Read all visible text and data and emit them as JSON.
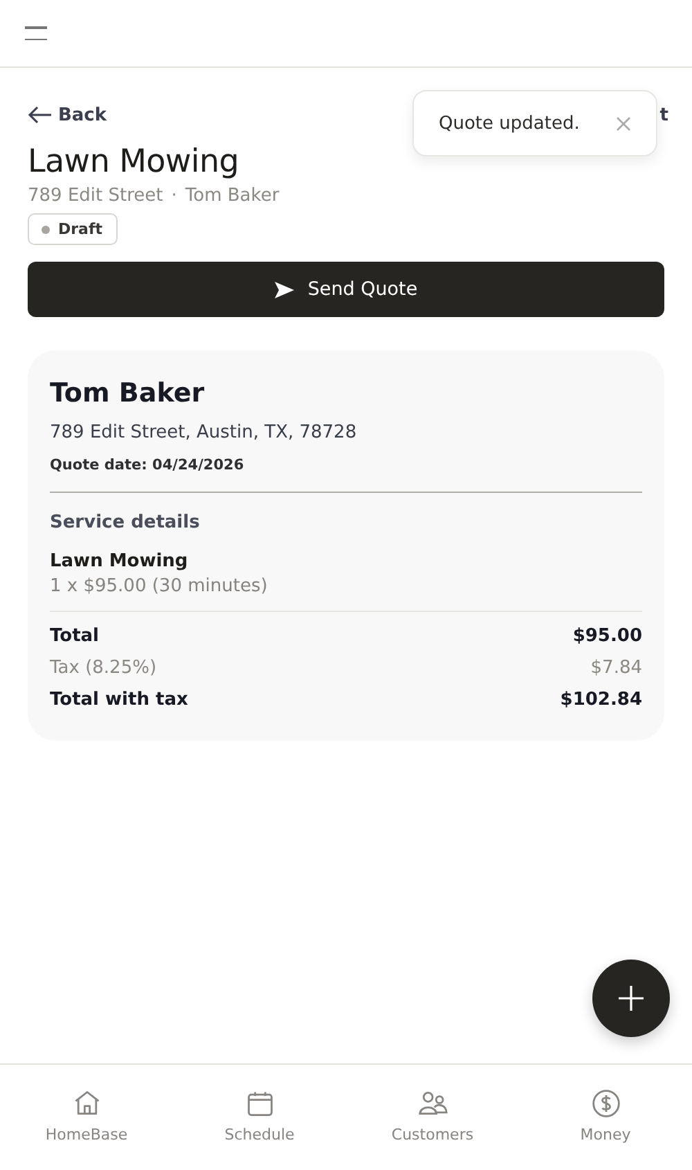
{
  "back": {
    "label": "Back",
    "right_link": "t"
  },
  "toast": {
    "message": "Quote updated."
  },
  "title": "Lawn Mowing",
  "subtitle": {
    "address": "789 Edit Street",
    "separator": "·",
    "customer": "Tom Baker"
  },
  "status": {
    "label": "Draft",
    "color": "#a8a49e"
  },
  "send_button": "Send Quote",
  "card": {
    "name": "Tom Baker",
    "address": "789 Edit Street, Austin, TX, 78728",
    "quote_date": "Quote date: 04/24/2026",
    "section": "Service details",
    "items": [
      {
        "name": "Lawn Mowing",
        "detail": "1 x $95.00 (30 minutes)"
      }
    ],
    "totals": [
      {
        "kind": "strong",
        "label": "Total",
        "value": "$95.00"
      },
      {
        "kind": "muted",
        "label": "Tax (8.25%)",
        "value": "$7.84"
      },
      {
        "kind": "strong",
        "label": "Total with tax",
        "value": "$102.84"
      }
    ]
  },
  "nav": [
    {
      "kind": "home",
      "label": "HomeBase"
    },
    {
      "kind": "calendar",
      "label": "Schedule"
    },
    {
      "kind": "people",
      "label": "Customers"
    },
    {
      "kind": "dollar",
      "label": "Money"
    }
  ]
}
